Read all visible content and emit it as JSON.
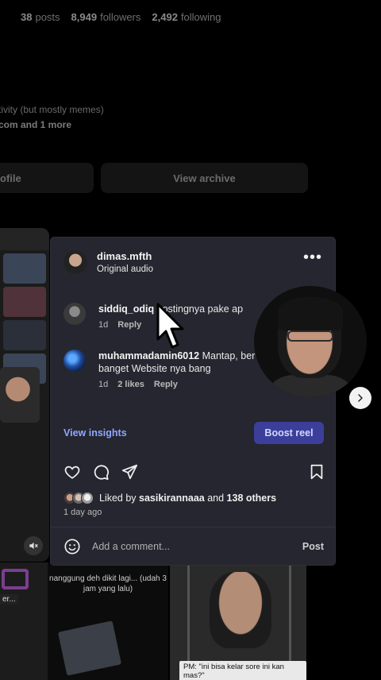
{
  "profile": {
    "stats": [
      {
        "value": "38",
        "label": "posts"
      },
      {
        "value": "8,949",
        "label": "followers"
      },
      {
        "value": "2,492",
        "label": "following"
      }
    ],
    "bio_line": "tivity (but mostly memes)",
    "bio_link": "com and 1 more",
    "edit_button": "ofile",
    "archive_button": "View archive"
  },
  "post": {
    "author": "dimas.mfth",
    "audio": "Original audio",
    "comments": [
      {
        "user": "siddiq_odiq",
        "text": " hostingnya pake ap",
        "time": "1d",
        "reply": "Reply"
      },
      {
        "user": "muhammadamin6012",
        "text": " Mantap, ber banget Website nya bang",
        "time": "1d",
        "likes": "2 likes",
        "reply": "Reply"
      }
    ],
    "view_insights": "View insights",
    "boost": "Boost reel",
    "liked_by_prefix": "Liked by ",
    "liked_by_user": "sasikirannaaa",
    "liked_by_mid": " and ",
    "liked_by_count": "138 others",
    "date": "1 day ago",
    "add_comment_placeholder": "Add a comment...",
    "post_button": "Post"
  },
  "thumbnails": {
    "t1_text": "er...",
    "t2_caption": "nanggung deh dikit lagi... (udah 3 jam yang lalu)",
    "t3_caption": "PM: \"ini bisa kelar sore ini kan mas?\""
  },
  "icons": {
    "more": "more-icon",
    "like": "heart-icon",
    "comment": "comment-icon",
    "share": "send-icon",
    "save": "bookmark-icon",
    "emoji": "emoji-icon",
    "next": "chevron-right-icon",
    "mute": "speaker-muted-icon"
  },
  "colors": {
    "panel_bg": "#262630",
    "link_accent": "#8ea8ff",
    "boost_bg": "#3c3f9a"
  }
}
